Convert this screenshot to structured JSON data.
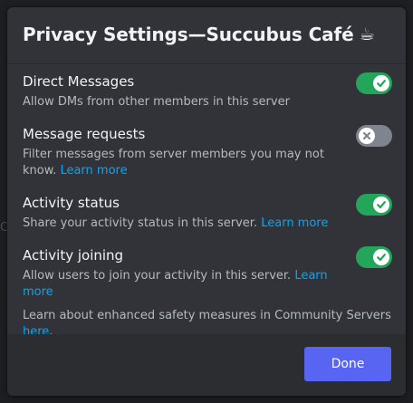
{
  "background": {
    "peek_text": "Co"
  },
  "modal": {
    "title": "Privacy Settings—Succubus Café",
    "title_emoji": "☕"
  },
  "settings": [
    {
      "title": "Direct Messages",
      "description": "Allow DMs from other members in this server",
      "link": "",
      "enabled": true
    },
    {
      "title": "Message requests",
      "description": "Filter messages from server members you may not know.",
      "link": "Learn more",
      "enabled": false
    },
    {
      "title": "Activity status",
      "description": "Share your activity status in this server.",
      "link": "Learn more",
      "enabled": true
    },
    {
      "title": "Activity joining",
      "description": "Allow users to join your activity in this server.",
      "link": "Learn more",
      "enabled": true
    }
  ],
  "safety_note": {
    "text": "Learn about enhanced safety measures in Community Servers",
    "link": "here",
    "suffix": "."
  },
  "footer": {
    "done_label": "Done"
  },
  "colors": {
    "toggle_on": "#23a55a",
    "toggle_off": "#80848e",
    "accent_button": "#5865f2",
    "link": "#00a8fc"
  },
  "icons": {
    "toggle_on_icon": "checkmark-icon",
    "toggle_off_icon": "x-icon"
  }
}
